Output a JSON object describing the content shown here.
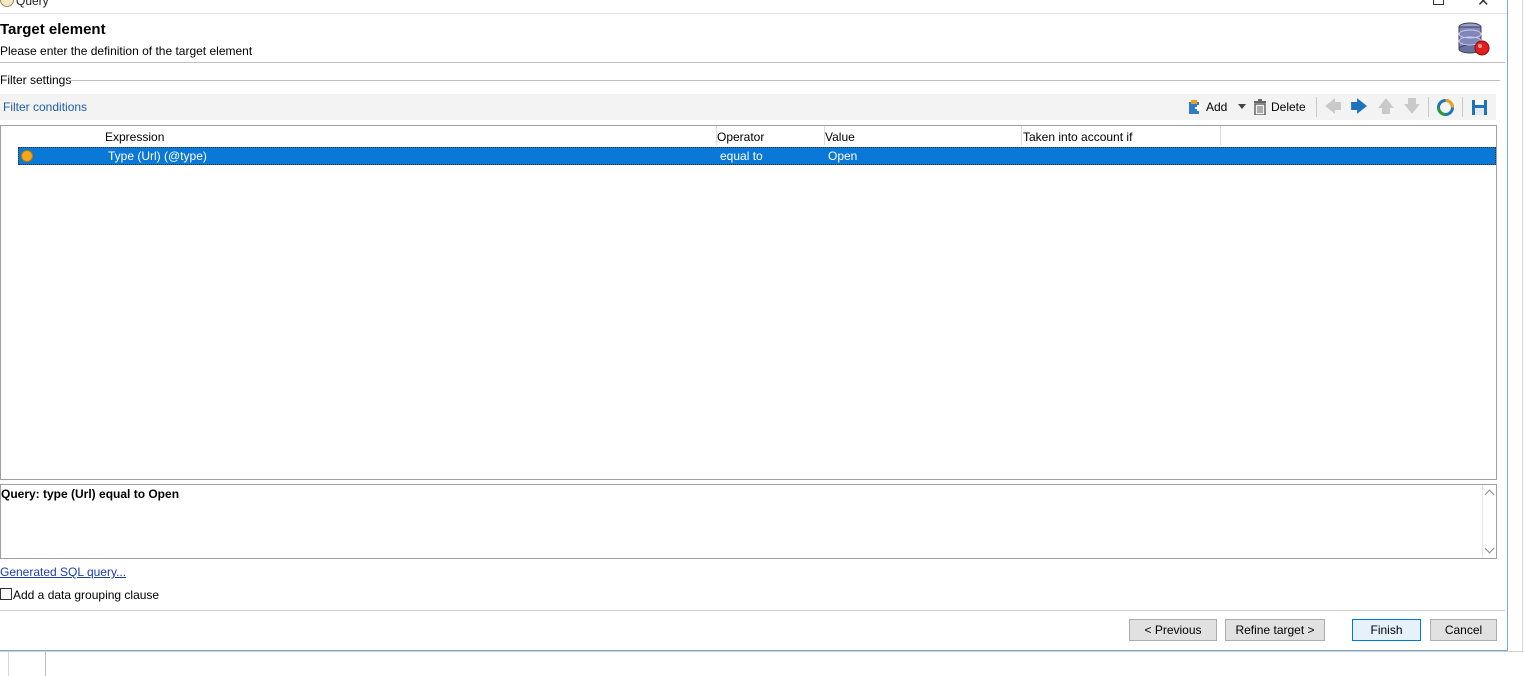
{
  "window": {
    "title": "Query"
  },
  "header": {
    "title": "Target element",
    "subtitle": "Please enter the definition of the target element"
  },
  "filter_settings": {
    "legend": "Filter settings",
    "conditions_label": "Filter conditions"
  },
  "toolbar": {
    "add_label": "Add",
    "delete_label": "Delete",
    "icons": [
      "add-icon",
      "dropdown-icon",
      "delete-icon",
      "arrow-left-icon",
      "arrow-right-icon",
      "arrow-up-icon",
      "arrow-down-icon",
      "distribution-icon",
      "save-icon"
    ],
    "colors": {
      "enabled_arrow": "#1e73be",
      "disabled_arrow": "#c9c9c9",
      "link": "#1f5ea8"
    }
  },
  "grid": {
    "columns": [
      "Expression",
      "Operator",
      "Value",
      "Taken into account if"
    ],
    "rows": [
      {
        "expression": "Type (Url) (@type)",
        "operator": "equal to",
        "value": "Open",
        "condition": ""
      }
    ],
    "selection_color": "#0a78d7"
  },
  "query": {
    "summary": "Query: type (Url) equal to Open"
  },
  "links": {
    "generated_sql": "Generated SQL query..."
  },
  "grouping": {
    "label": "Add a data grouping clause",
    "checked": false
  },
  "buttons": {
    "previous": "< Previous",
    "refine": "Refine target >",
    "finish": "Finish",
    "cancel": "Cancel"
  }
}
